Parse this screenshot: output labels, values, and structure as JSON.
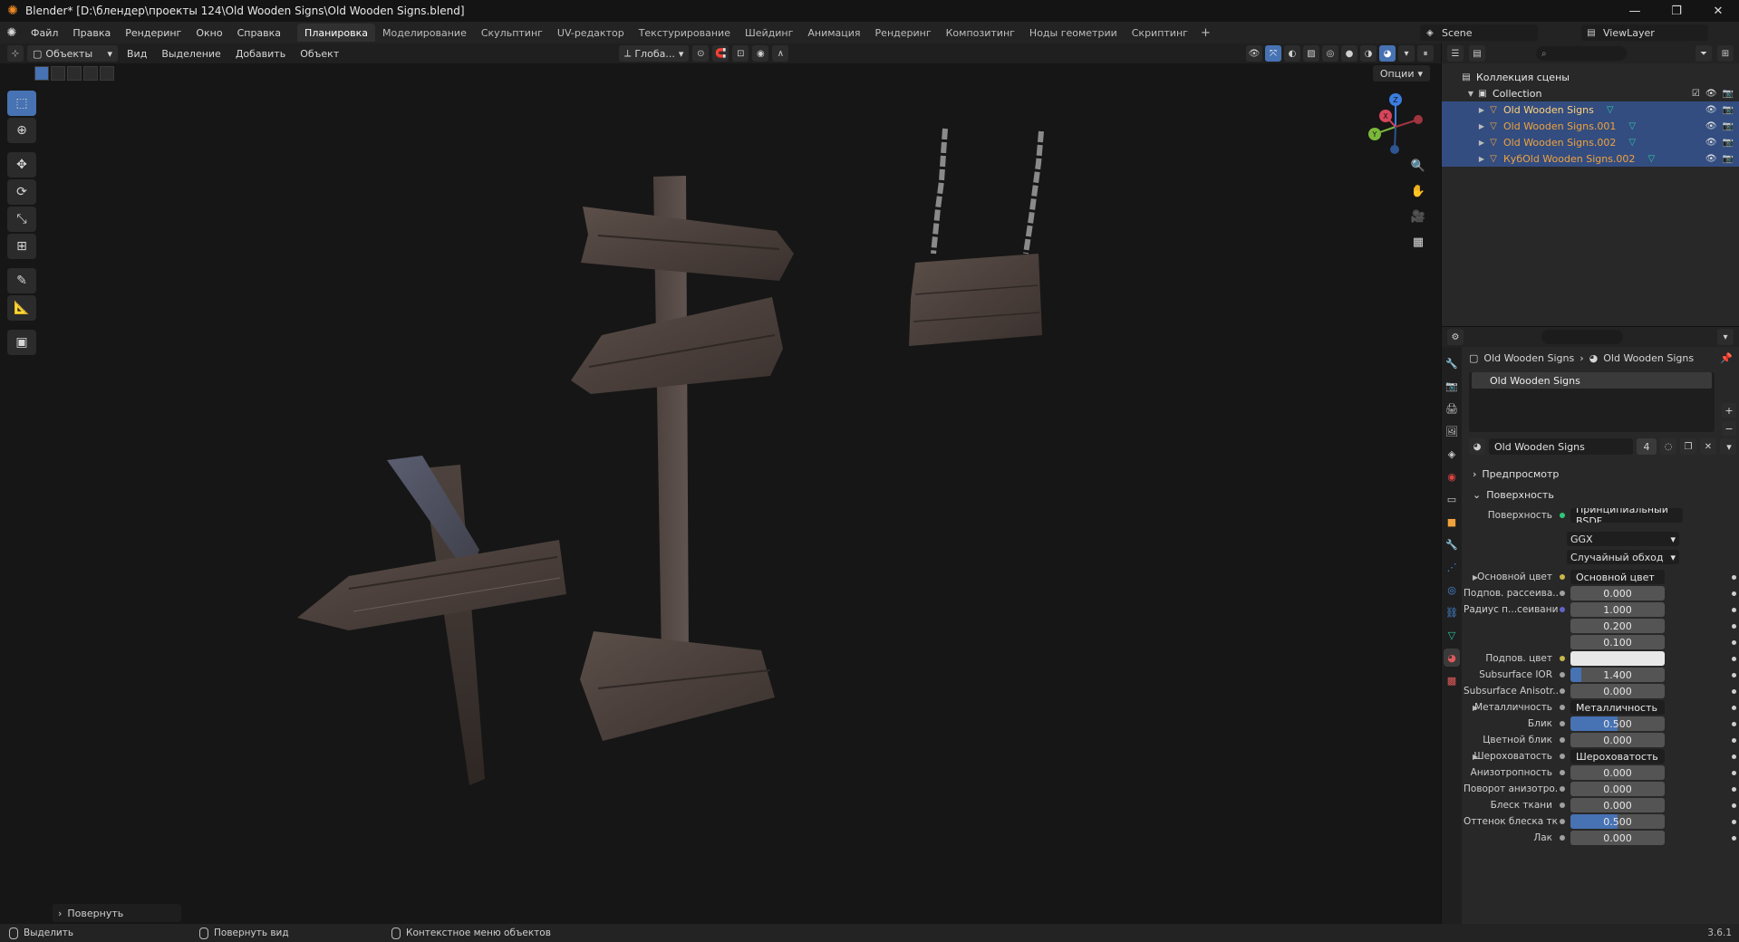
{
  "window": {
    "title": "Blender* [D:\\блендер\\проекты 124\\Old Wooden Signs\\Old Wooden Signs.blend]"
  },
  "topbar": {
    "menus": [
      "Файл",
      "Правка",
      "Рендеринг",
      "Окно",
      "Справка"
    ],
    "workspaces": [
      "Планировка",
      "Моделирование",
      "Скульптинг",
      "UV-редактор",
      "Текстурирование",
      "Шейдинг",
      "Анимация",
      "Рендеринг",
      "Композитинг",
      "Ноды геометрии",
      "Скриптинг"
    ],
    "active_workspace": "Планировка",
    "scene": "Scene",
    "view_layer": "ViewLayer"
  },
  "viewport_header": {
    "mode": "Объекты",
    "menus": [
      "Вид",
      "Выделение",
      "Добавить",
      "Объект"
    ],
    "transform_orientation": "Глоба...",
    "options": "Опции"
  },
  "last_operator": "Повернуть",
  "gizmo": {
    "x": "X",
    "y": "Y",
    "z": "Z"
  },
  "outliner": {
    "root": "Коллекция сцены",
    "collection": "Collection",
    "objects": [
      {
        "name": "Old Wooden Signs",
        "selected": true
      },
      {
        "name": "Old Wooden Signs.001",
        "selected": true
      },
      {
        "name": "Old Wooden Signs.002",
        "selected": true
      },
      {
        "name": "КубOld Wooden Signs.002",
        "selected": true
      }
    ]
  },
  "properties": {
    "breadcrumb_object": "Old Wooden Signs",
    "breadcrumb_material": "Old Wooden Signs",
    "material_slot": "Old Wooden Signs",
    "material_name": "Old Wooden Signs",
    "material_users": "4",
    "panel_preview": "Предпросмотр",
    "panel_surface": "Поверхность",
    "surface_label": "Поверхность",
    "surface_value": "Принципиальный BSDF",
    "distribution": "GGX",
    "subsurface_method": "Случайный обход",
    "rows": [
      {
        "label": "Основной цвет",
        "value": "Основной цвет",
        "kind": "socket",
        "expand": true,
        "dot": "#c8b84a"
      },
      {
        "label": "Подпов. рассеива...",
        "value": "0.000",
        "kind": "num",
        "fill": 0,
        "dot": "#a0a0a0"
      },
      {
        "label": "Радиус п...сеивания",
        "value": "1.000",
        "kind": "num",
        "fill": 0,
        "dot": "#6363c7"
      },
      {
        "label": "",
        "value": "0.200",
        "kind": "num",
        "fill": 0,
        "dot": ""
      },
      {
        "label": "",
        "value": "0.100",
        "kind": "num",
        "fill": 0,
        "dot": ""
      },
      {
        "label": "Подпов. цвет",
        "value": "",
        "kind": "color",
        "fill": 0,
        "dot": "#c8b84a"
      },
      {
        "label": "Subsurface IOR",
        "value": "1.400",
        "kind": "num",
        "fill": 0.12,
        "dot": "#a0a0a0"
      },
      {
        "label": "Subsurface Anisotr...",
        "value": "0.000",
        "kind": "num",
        "fill": 0,
        "dot": "#a0a0a0"
      },
      {
        "label": "Металличность",
        "value": "Металличность",
        "kind": "socket",
        "expand": true,
        "dot": "#a0a0a0"
      },
      {
        "label": "Блик",
        "value": "0.500",
        "kind": "num",
        "fill": 0.5,
        "dot": "#a0a0a0"
      },
      {
        "label": "Цветной блик",
        "value": "0.000",
        "kind": "num",
        "fill": 0,
        "dot": "#a0a0a0"
      },
      {
        "label": "Шероховатость",
        "value": "Шероховатость",
        "kind": "socket",
        "expand": true,
        "dot": "#a0a0a0"
      },
      {
        "label": "Анизотропность",
        "value": "0.000",
        "kind": "num",
        "fill": 0,
        "dot": "#a0a0a0"
      },
      {
        "label": "Поворот анизотро...",
        "value": "0.000",
        "kind": "num",
        "fill": 0,
        "dot": "#a0a0a0"
      },
      {
        "label": "Блеск ткани",
        "value": "0.000",
        "kind": "num",
        "fill": 0,
        "dot": "#a0a0a0"
      },
      {
        "label": "Оттенок блеска тк...",
        "value": "0.500",
        "kind": "num",
        "fill": 0.5,
        "dot": "#a0a0a0"
      },
      {
        "label": "Лак",
        "value": "0.000",
        "kind": "num",
        "fill": 0,
        "dot": "#a0a0a0"
      }
    ]
  },
  "statusbar": {
    "select": "Выделить",
    "rotate_view": "Повернуть вид",
    "context_menu": "Контекстное меню объектов",
    "version": "3.6.1"
  },
  "colors": {
    "accent": "#4772b3",
    "object_orange": "#f0a23c",
    "selected_row": "#334d80",
    "wood_dark": "#3b3330",
    "wood_mid": "#574a44"
  }
}
